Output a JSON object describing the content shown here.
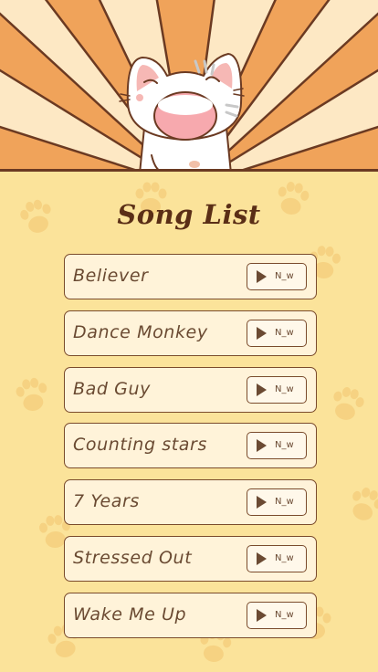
{
  "screen": {
    "title": "Song List"
  },
  "songs": [
    {
      "title": "Believer",
      "button_label": "N_w"
    },
    {
      "title": "Dance Monkey",
      "button_label": "N_w"
    },
    {
      "title": "Bad Guy",
      "button_label": "N_w"
    },
    {
      "title": "Counting stars",
      "button_label": "N_w"
    },
    {
      "title": "7 Years",
      "button_label": "N_w"
    },
    {
      "title": "Stressed Out",
      "button_label": "N_w"
    },
    {
      "title": "Wake Me Up",
      "button_label": "N_w"
    }
  ],
  "colors": {
    "background": "#fbe39a",
    "ray_dark": "#f0a35a",
    "ray_light": "#fde8c4",
    "outline": "#6b3a22",
    "card": "#fff3d9",
    "text": "#6a4a32"
  },
  "icons": {
    "mascot": "singing-cat-icon",
    "paw": "paw-print-icon",
    "play": "play-icon"
  }
}
